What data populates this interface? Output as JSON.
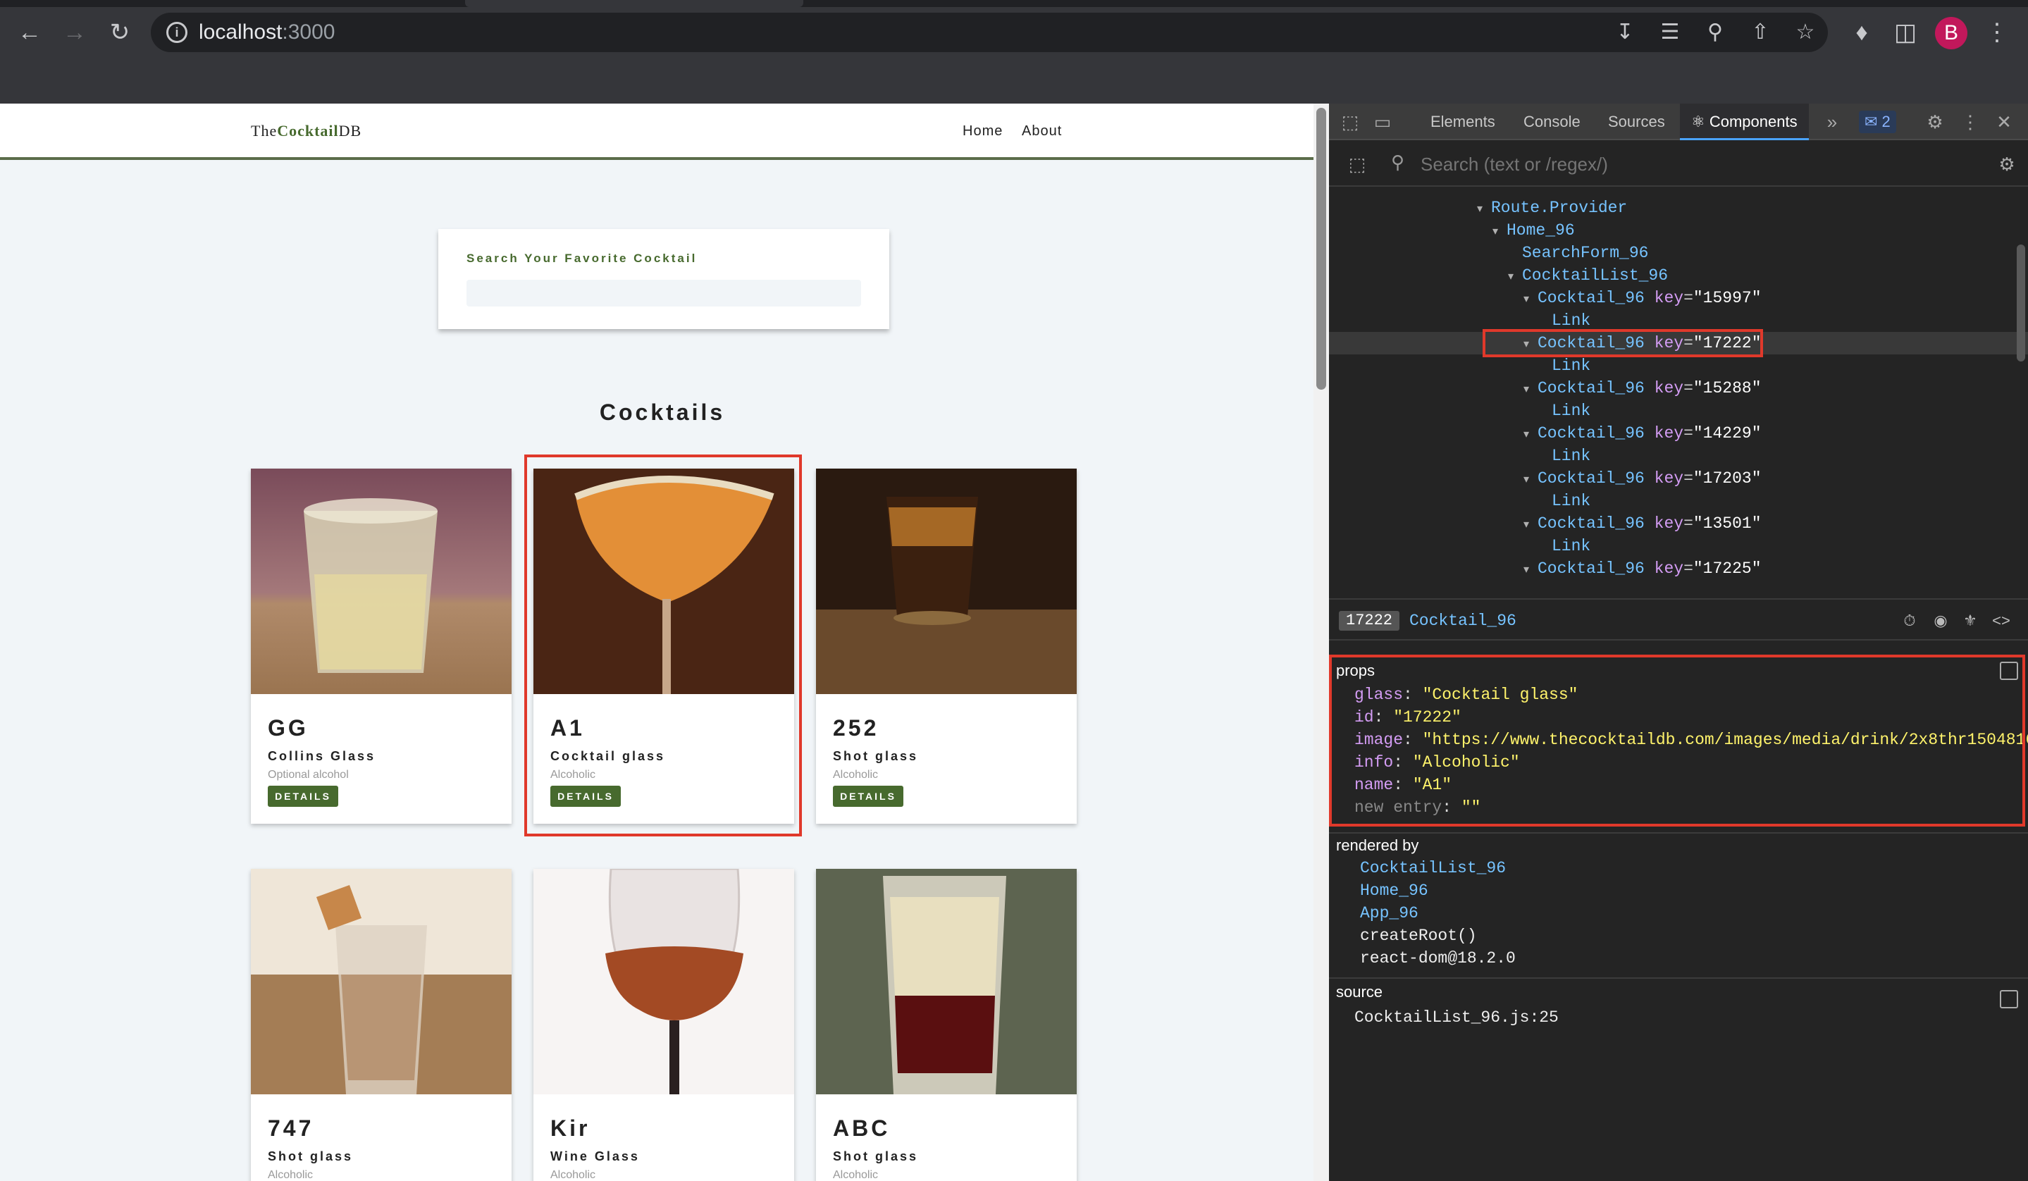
{
  "browser": {
    "url_host": "localhost",
    "url_port": ":3000",
    "avatar_letter": "B"
  },
  "site": {
    "logo_pre": "The",
    "logo_bold": "Cocktail",
    "logo_post": "DB",
    "nav": [
      "Home",
      "About"
    ],
    "search_label": "Search Your Favorite Cocktail",
    "section_title": "Cocktails",
    "details_label": "DETAILS",
    "cards": [
      {
        "name": "GG",
        "glass": "Collins Glass",
        "info": "Optional alcohol"
      },
      {
        "name": "A1",
        "glass": "Cocktail glass",
        "info": "Alcoholic"
      },
      {
        "name": "252",
        "glass": "Shot glass",
        "info": "Alcoholic"
      },
      {
        "name": "747",
        "glass": "Shot glass",
        "info": "Alcoholic"
      },
      {
        "name": "Kir",
        "glass": "Wine Glass",
        "info": "Alcoholic"
      },
      {
        "name": "ABC",
        "glass": "Shot glass",
        "info": "Alcoholic"
      }
    ]
  },
  "devtools": {
    "tabs": [
      "Elements",
      "Console",
      "Sources",
      "Components"
    ],
    "badge": "2",
    "search_placeholder": "Search (text or /regex/)",
    "tree": {
      "route": "Route.Provider",
      "home": "Home_96",
      "search_form": "SearchForm_96",
      "list": "CocktailList_96",
      "item": "Cocktail_96",
      "link": "Link",
      "keys": [
        "\"15997\"",
        "\"17222\"",
        "\"15288\"",
        "\"14229\"",
        "\"17203\"",
        "\"13501\"",
        "\"17225\""
      ]
    },
    "selected": {
      "key": "17222",
      "name": "Cocktail_96"
    },
    "props_title": "props",
    "props": [
      {
        "k": "glass",
        "v": "\"Cocktail glass\""
      },
      {
        "k": "id",
        "v": "\"17222\""
      },
      {
        "k": "image",
        "v": "\"https://www.thecocktaildb.com/images/media/drink/2x8thr150481692"
      },
      {
        "k": "info",
        "v": "\"Alcoholic\""
      },
      {
        "k": "name",
        "v": "\"A1\""
      },
      {
        "k": "new entry",
        "v": "\"\""
      }
    ],
    "rendered_by_title": "rendered by",
    "rendered_by": [
      "CocktailList_96",
      "Home_96",
      "App_96"
    ],
    "rendered_plain": [
      "createRoot()",
      "react-dom@18.2.0"
    ],
    "source_title": "source",
    "source": "CocktailList_96.js:25"
  }
}
